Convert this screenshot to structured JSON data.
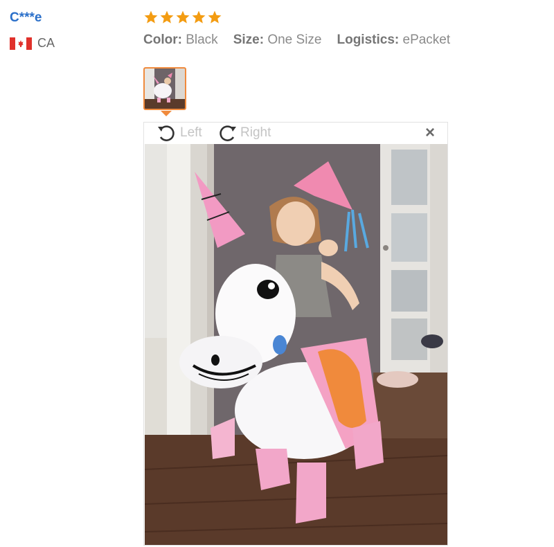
{
  "reviewer": {
    "name": "C***e",
    "country_code": "CA"
  },
  "review": {
    "rating": 5,
    "star_color": "#f39c12",
    "attributes": [
      {
        "key": "Color:",
        "value": "Black"
      },
      {
        "key": "Size:",
        "value": "One Size"
      },
      {
        "key": "Logistics:",
        "value": "ePacket"
      }
    ]
  },
  "viewer": {
    "rotate_left_label": "Left",
    "rotate_right_label": "Right",
    "close_symbol": "×"
  },
  "icons": {
    "rotate_left": "rotate-left-icon",
    "rotate_right": "rotate-right-icon",
    "close": "close-icon",
    "flag": "canada-flag-icon",
    "star": "star-icon"
  },
  "colors": {
    "accent": "#f08a3c",
    "name_link": "#2a6fc9"
  }
}
